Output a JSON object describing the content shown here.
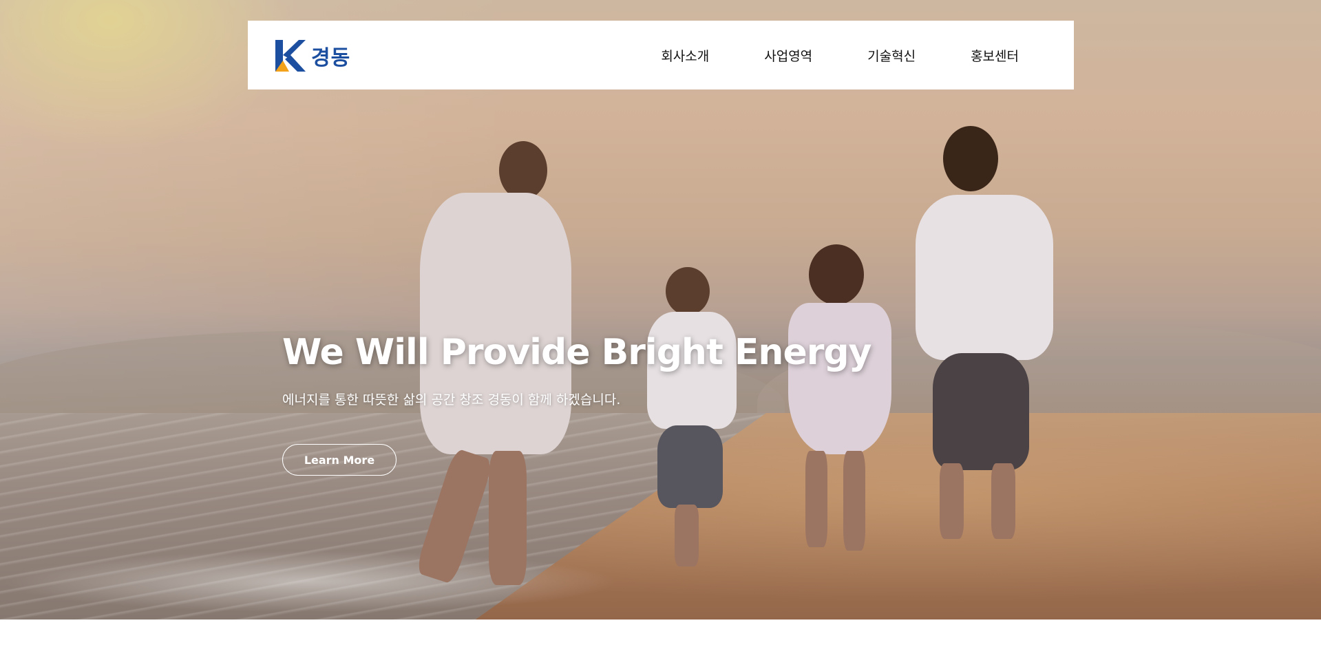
{
  "header": {
    "logo_text": "경동",
    "nav": [
      "회사소개",
      "사업영역",
      "기술혁신",
      "홍보센터"
    ]
  },
  "hero": {
    "title": "We Will Provide Bright Energy",
    "subtitle": "에너지를 통한 따뜻한 삶의 공간 창조 경동이 함께 하겠습니다.",
    "button_label": "Learn More"
  },
  "colors": {
    "brand_blue": "#1d4fa0",
    "brand_orange": "#f3a21b",
    "nav_text": "#111111",
    "hero_text": "#ffffff"
  }
}
